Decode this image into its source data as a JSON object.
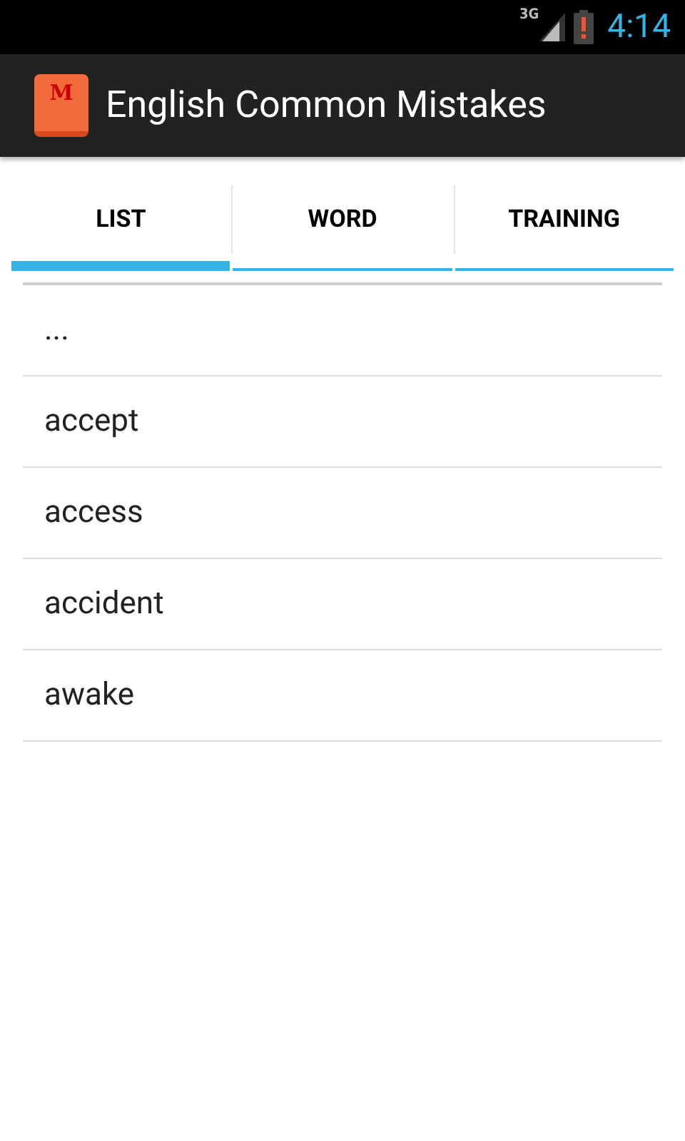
{
  "status_bar": {
    "network": "3G",
    "time": "4:14"
  },
  "action_bar": {
    "title": "English Common Mistakes",
    "logo_letter": "M"
  },
  "tabs": [
    {
      "label": "LIST",
      "selected": true
    },
    {
      "label": "WORD",
      "selected": false
    },
    {
      "label": "TRAINING",
      "selected": false
    }
  ],
  "list": {
    "items": [
      "...",
      "accept",
      "access",
      "accident",
      "awake"
    ]
  }
}
